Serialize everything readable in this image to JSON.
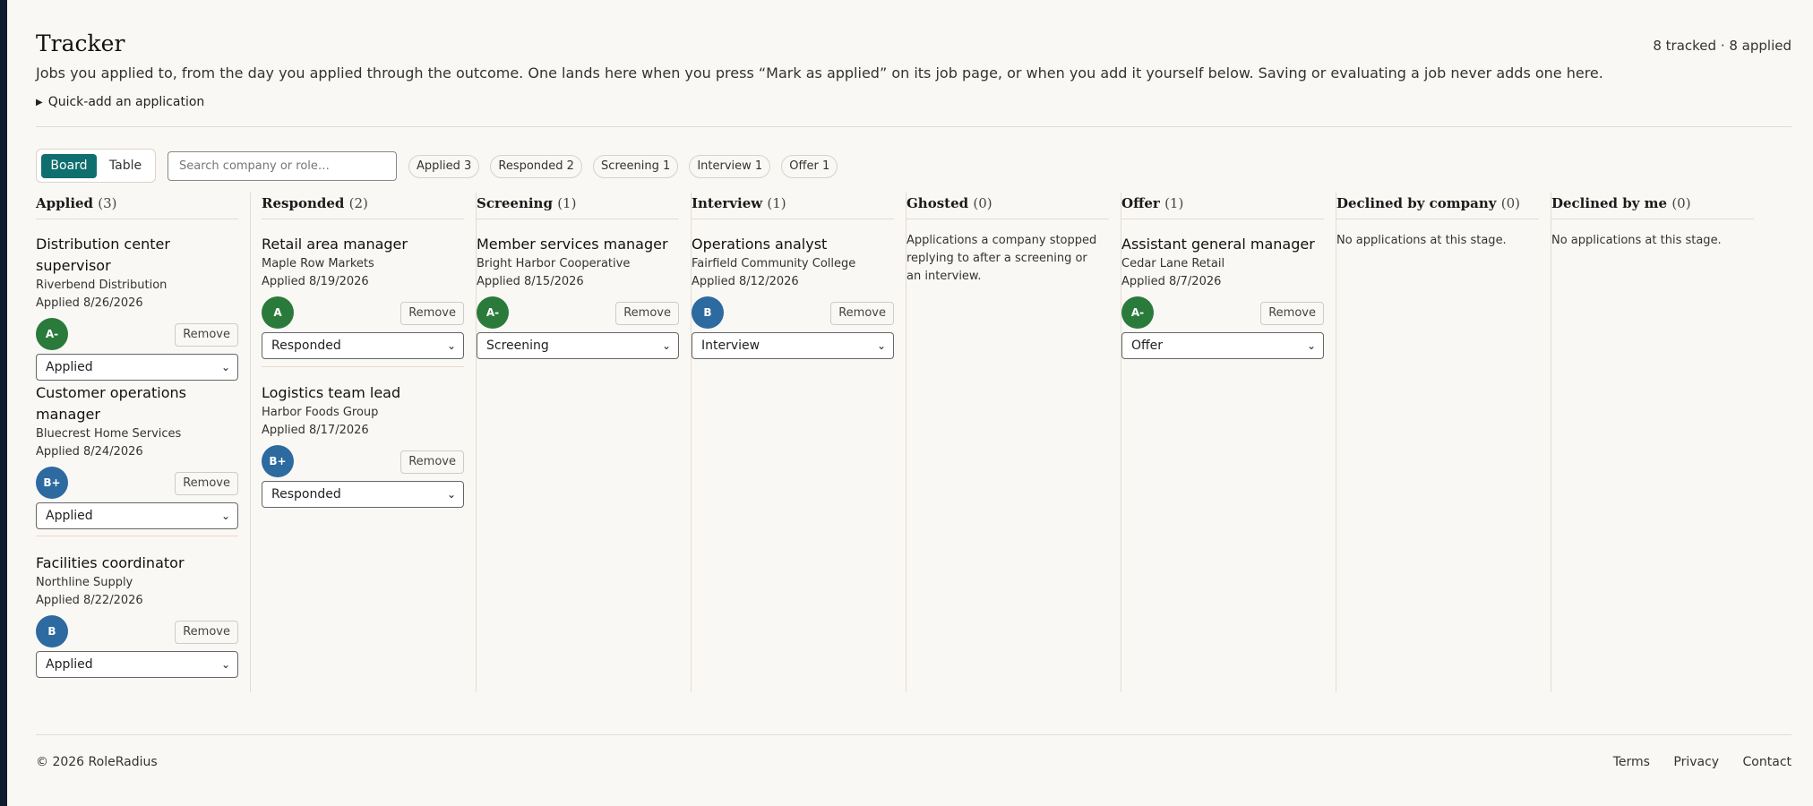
{
  "header": {
    "title": "Tracker",
    "counts": "8 tracked · 8 applied",
    "intro": "Jobs you applied to, from the day you applied through the outcome. One lands here when you press “Mark as applied” on its job page, or when you add it yourself below. Saving or evaluating a job never adds one here.",
    "quickadd": "Quick-add an application"
  },
  "toolbar": {
    "view_board": "Board",
    "view_table": "Table",
    "search_placeholder": "Search company or role…",
    "chips": [
      "Applied 3",
      "Responded 2",
      "Screening 1",
      "Interview 1",
      "Offer 1"
    ]
  },
  "columns": [
    {
      "name": "Applied",
      "count": "(3)"
    },
    {
      "name": "Responded",
      "count": "(2)"
    },
    {
      "name": "Screening",
      "count": "(1)"
    },
    {
      "name": "Interview",
      "count": "(1)"
    },
    {
      "name": "Ghosted",
      "count": "(0)",
      "empty": "Applications a company stopped replying to after a screening or an interview."
    },
    {
      "name": "Offer",
      "count": "(1)"
    },
    {
      "name": "Declined by company",
      "count": "(0)",
      "empty": "No applications at this stage."
    },
    {
      "name": "Declined by me",
      "count": "(0)",
      "empty": "No applications at this stage."
    }
  ],
  "cards": {
    "applied": [
      {
        "role": "Distribution center supervisor",
        "company": "Riverbend Distribution",
        "date": "Applied 8/26/2026",
        "grade": "A-",
        "status": "Applied"
      },
      {
        "role": "Customer operations manager",
        "company": "Bluecrest Home Services",
        "date": "Applied 8/24/2026",
        "grade": "B+",
        "status": "Applied"
      },
      {
        "role": "Facilities coordinator",
        "company": "Northline Supply",
        "date": "Applied 8/22/2026",
        "grade": "B",
        "status": "Applied"
      }
    ],
    "responded": [
      {
        "role": "Retail area manager",
        "company": "Maple Row Markets",
        "date": "Applied 8/19/2026",
        "grade": "A",
        "status": "Responded"
      },
      {
        "role": "Logistics team lead",
        "company": "Harbor Foods Group",
        "date": "Applied 8/17/2026",
        "grade": "B+",
        "status": "Responded"
      }
    ],
    "screening": [
      {
        "role": "Member services manager",
        "company": "Bright Harbor Cooperative",
        "date": "Applied 8/15/2026",
        "grade": "A-",
        "status": "Screening"
      }
    ],
    "interview": [
      {
        "role": "Operations analyst",
        "company": "Fairfield Community College",
        "date": "Applied 8/12/2026",
        "grade": "B",
        "status": "Interview"
      }
    ],
    "offer": [
      {
        "role": "Assistant general manager",
        "company": "Cedar Lane Retail",
        "date": "Applied 8/7/2026",
        "grade": "A-",
        "status": "Offer"
      }
    ]
  },
  "remove_label": "Remove",
  "colors": {
    "accent": "#0f6e6e",
    "grade_green": "#2a7a3b",
    "grade_blue": "#2c6aa0"
  },
  "footer": {
    "copyright": "© 2026 RoleRadius",
    "links": [
      "Terms",
      "Privacy",
      "Contact"
    ]
  }
}
